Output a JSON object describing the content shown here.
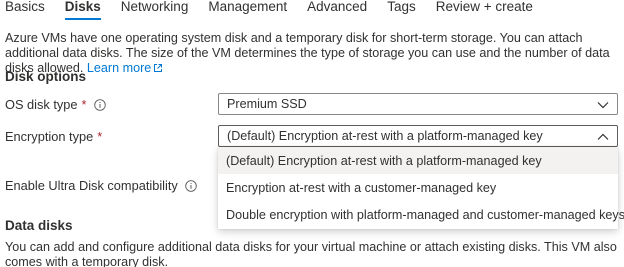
{
  "tabs": [
    {
      "label": "Basics",
      "active": false
    },
    {
      "label": "Disks",
      "active": true
    },
    {
      "label": "Networking",
      "active": false
    },
    {
      "label": "Management",
      "active": false
    },
    {
      "label": "Advanced",
      "active": false
    },
    {
      "label": "Tags",
      "active": false
    },
    {
      "label": "Review + create",
      "active": false
    }
  ],
  "intro": {
    "text": "Azure VMs have one operating system disk and a temporary disk for short-term storage. You can attach additional data disks. The size of the VM determines the type of storage you can use and the number of data disks allowed.",
    "link": "Learn more"
  },
  "disk_options": {
    "title": "Disk options",
    "os_disk_type": {
      "label": "OS disk type",
      "required_mark": "*",
      "value": "Premium SSD"
    },
    "encryption_type": {
      "label": "Encryption type",
      "required_mark": "*",
      "value": "(Default) Encryption at-rest with a platform-managed key",
      "options": [
        "(Default) Encryption at-rest with a platform-managed key",
        "Encryption at-rest with a customer-managed key",
        "Double encryption with platform-managed and customer-managed keys"
      ]
    },
    "ultra_disk": {
      "label": "Enable Ultra Disk compatibility"
    }
  },
  "data_disks": {
    "title": "Data disks",
    "text": "You can add and configure additional data disks for your virtual machine or attach existing disks. This VM also comes with a temporary disk."
  },
  "colors": {
    "accent": "#0078d4",
    "required": "#a4262c",
    "text": "#323130"
  }
}
